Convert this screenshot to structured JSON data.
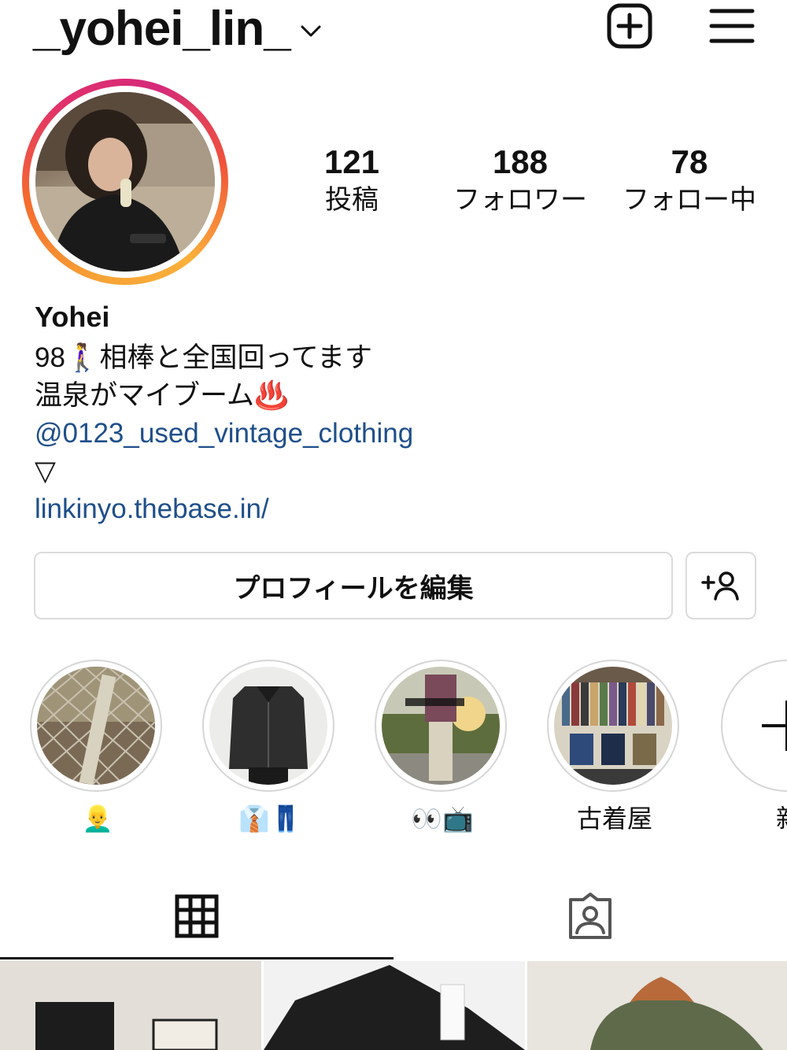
{
  "header": {
    "username": "_yohei_lin_"
  },
  "stats": [
    {
      "value": "121",
      "label": "投稿"
    },
    {
      "value": "188",
      "label": "フォロワー"
    },
    {
      "value": "78",
      "label": "フォロー中"
    }
  ],
  "bio": {
    "name": "Yohei",
    "line1": "98🚶‍♀️相棒と全国回ってます",
    "line2": "温泉がマイブーム♨️",
    "mention": "@0123_used_vintage_clothing",
    "arrow": "▽",
    "website": "linkinyo.thebase.in/"
  },
  "buttons": {
    "edit_profile": "プロフィールを編集"
  },
  "highlights": [
    {
      "label": "👱‍♂️"
    },
    {
      "label": "👔👖"
    },
    {
      "label": "👀📺"
    },
    {
      "label": "古着屋"
    },
    {
      "label": "新"
    }
  ],
  "tabs": [
    {
      "icon": "grid-icon",
      "active": true
    },
    {
      "icon": "tagged-icon",
      "active": false
    }
  ],
  "colors": {
    "link": "#1f4f8a",
    "border": "#dbdbdb",
    "story_ring_start": "#f7a135",
    "story_ring_end": "#e1306c"
  }
}
